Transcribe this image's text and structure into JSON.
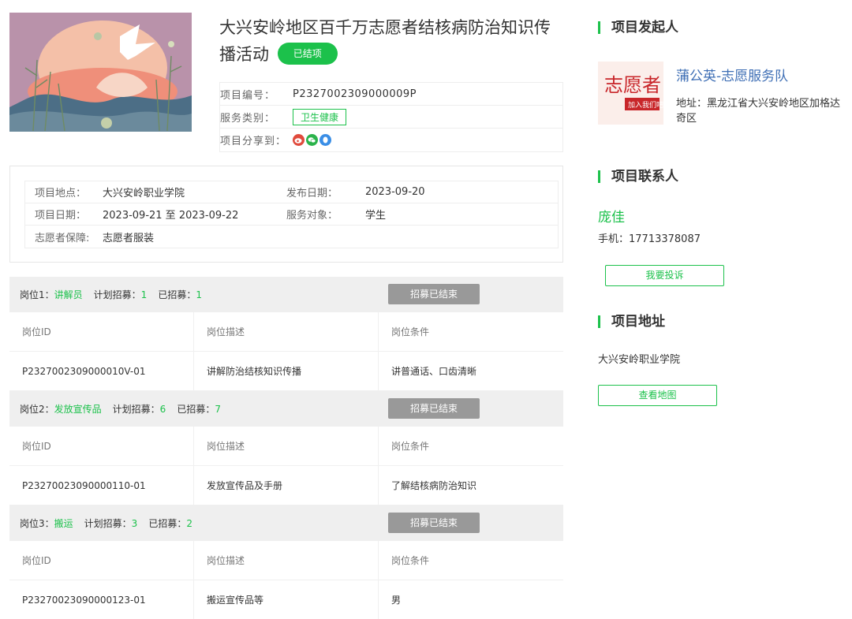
{
  "project": {
    "title": "大兴安岭地区百千万志愿者结核病防治知识传播活动",
    "status": "已结项",
    "code_label": "项目编号：",
    "code": "P2327002309000009P",
    "category_label": "服务类别：",
    "category": "卫生健康",
    "share_label": "项目分享到：",
    "share_icons": [
      "weibo-icon",
      "wechat-icon",
      "qq-icon"
    ]
  },
  "info": {
    "location_label": "项目地点：",
    "location": "大兴安岭职业学院",
    "publish_label": "发布日期：",
    "publish_date": "2023-09-20",
    "date_label": "项目日期：",
    "date_range": "2023-09-21 至 2023-09-22",
    "target_label": "服务对象：",
    "target": "学生",
    "guarantee_label": "志愿者保障:",
    "guarantee": "志愿者服装"
  },
  "positions": [
    {
      "prefix": "岗位1：",
      "name": "讲解员",
      "planned_label": "计划招募：",
      "planned": "1",
      "recruited_label": "已招募：",
      "recruited": "1",
      "button": "招募已结束",
      "headers": [
        "岗位ID",
        "岗位描述",
        "岗位条件"
      ],
      "row": [
        "P2327002309000010V-01",
        "讲解防治结核知识传播",
        "讲普通话、口齿清晰"
      ]
    },
    {
      "prefix": "岗位2：",
      "name": "发放宣传品",
      "planned_label": "计划招募：",
      "planned": "6",
      "recruited_label": "已招募：",
      "recruited": "7",
      "button": "招募已结束",
      "headers": [
        "岗位ID",
        "岗位描述",
        "岗位条件"
      ],
      "row": [
        "P23270023090000110-01",
        "发放宣传品及手册",
        "了解结核病防治知识"
      ]
    },
    {
      "prefix": "岗位3：",
      "name": "搬运",
      "planned_label": "计划招募：",
      "planned": "3",
      "recruited_label": "已招募：",
      "recruited": "2",
      "button": "招募已结束",
      "headers": [
        "岗位ID",
        "岗位描述",
        "岗位条件"
      ],
      "row": [
        "P23270023090000123-01",
        "搬运宣传品等",
        "男"
      ]
    }
  ],
  "sidebar": {
    "initiator_title": "项目发起人",
    "org_logo_text": "志愿者",
    "org_logo_subtext": "加入我们吧",
    "org_name": "蒲公英-志愿服务队",
    "org_address": "地址：黑龙江省大兴安岭地区加格达奇区",
    "contact_title": "项目联系人",
    "contact_name": "庞佳",
    "contact_phone": "手机：17713378087",
    "complain_button": "我要投诉",
    "address_title": "项目地址",
    "address": "大兴安岭职业学院",
    "map_button": "查看地图"
  },
  "colors": {
    "accent": "#1cc14b",
    "link": "#3f6fb5",
    "ended_button": "#999999"
  }
}
